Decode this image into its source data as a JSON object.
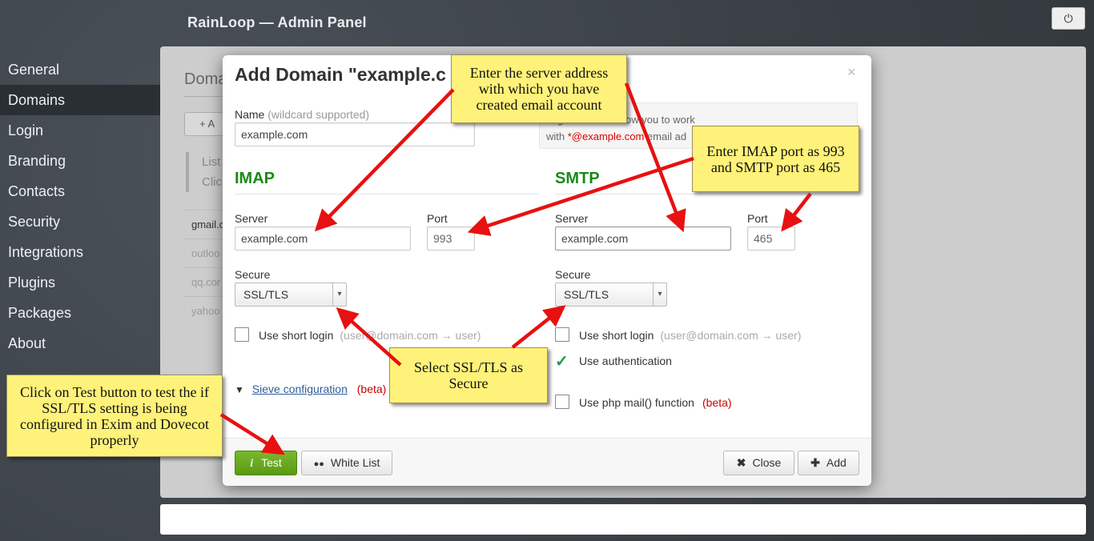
{
  "app": {
    "title": "RainLoop — Admin Panel",
    "power_icon": "⏻"
  },
  "sidebar": {
    "items": [
      {
        "label": "General"
      },
      {
        "label": "Domains",
        "active": true
      },
      {
        "label": "Login"
      },
      {
        "label": "Branding"
      },
      {
        "label": "Contacts"
      },
      {
        "label": "Security"
      },
      {
        "label": "Integrations"
      },
      {
        "label": "Plugins"
      },
      {
        "label": "Packages"
      },
      {
        "label": "About"
      }
    ]
  },
  "background_panel": {
    "title": "Doma",
    "add_button": "+ A",
    "info_line1": "List",
    "info_line2": "Clic",
    "domains": [
      "gmail.c",
      "outloo",
      "qq.cor",
      "yahoo"
    ]
  },
  "modal": {
    "title": "Add Domain \"example.c",
    "close_glyph": "×",
    "name_label": "Name",
    "name_hint": "(wildcard supported)",
    "name_value": "example.com",
    "note_line1": "nfiguration will allow you to work",
    "note_with": "with ",
    "note_domain": "*@example.com",
    "note_tail": " email ad",
    "imap": {
      "heading": "IMAP",
      "server_label": "Server",
      "server_value": "example.com",
      "port_label": "Port",
      "port_value": "993",
      "secure_label": "Secure",
      "secure_value": "SSL/TLS",
      "short_login_label": "Use short login",
      "short_login_hint": "(user@domain.com → user)"
    },
    "smtp": {
      "heading": "SMTP",
      "server_label": "Server",
      "server_value": "example.com",
      "port_label": "Port",
      "port_value": "465",
      "secure_label": "Secure",
      "secure_value": "SSL/TLS",
      "short_login_label": "Use short login",
      "short_login_hint": "(user@domain.com → user)",
      "auth_label": "Use authentication",
      "auth_checked": true,
      "php_mail_label": "Use php mail() function",
      "php_mail_beta": "(beta)"
    },
    "sieve": {
      "link": "Sieve configuration",
      "beta": "(beta)"
    },
    "footer": {
      "test": "Test",
      "white_list": "White List",
      "close": "Close",
      "add": "Add"
    }
  },
  "callouts": {
    "server": "Enter the server address with which you have created email account",
    "ports": "Enter IMAP port as 993 and SMTP port as 465",
    "secure": "Select SSL/TLS as Secure",
    "test": "Click on Test button to test the if SSL/TLS setting is being configured in Exim and Dovecot properly"
  },
  "colors": {
    "accent_green": "#1a8a1a",
    "test_button": "#6aaa20",
    "callout_bg": "#fff27a",
    "arrow": "#e81010"
  }
}
